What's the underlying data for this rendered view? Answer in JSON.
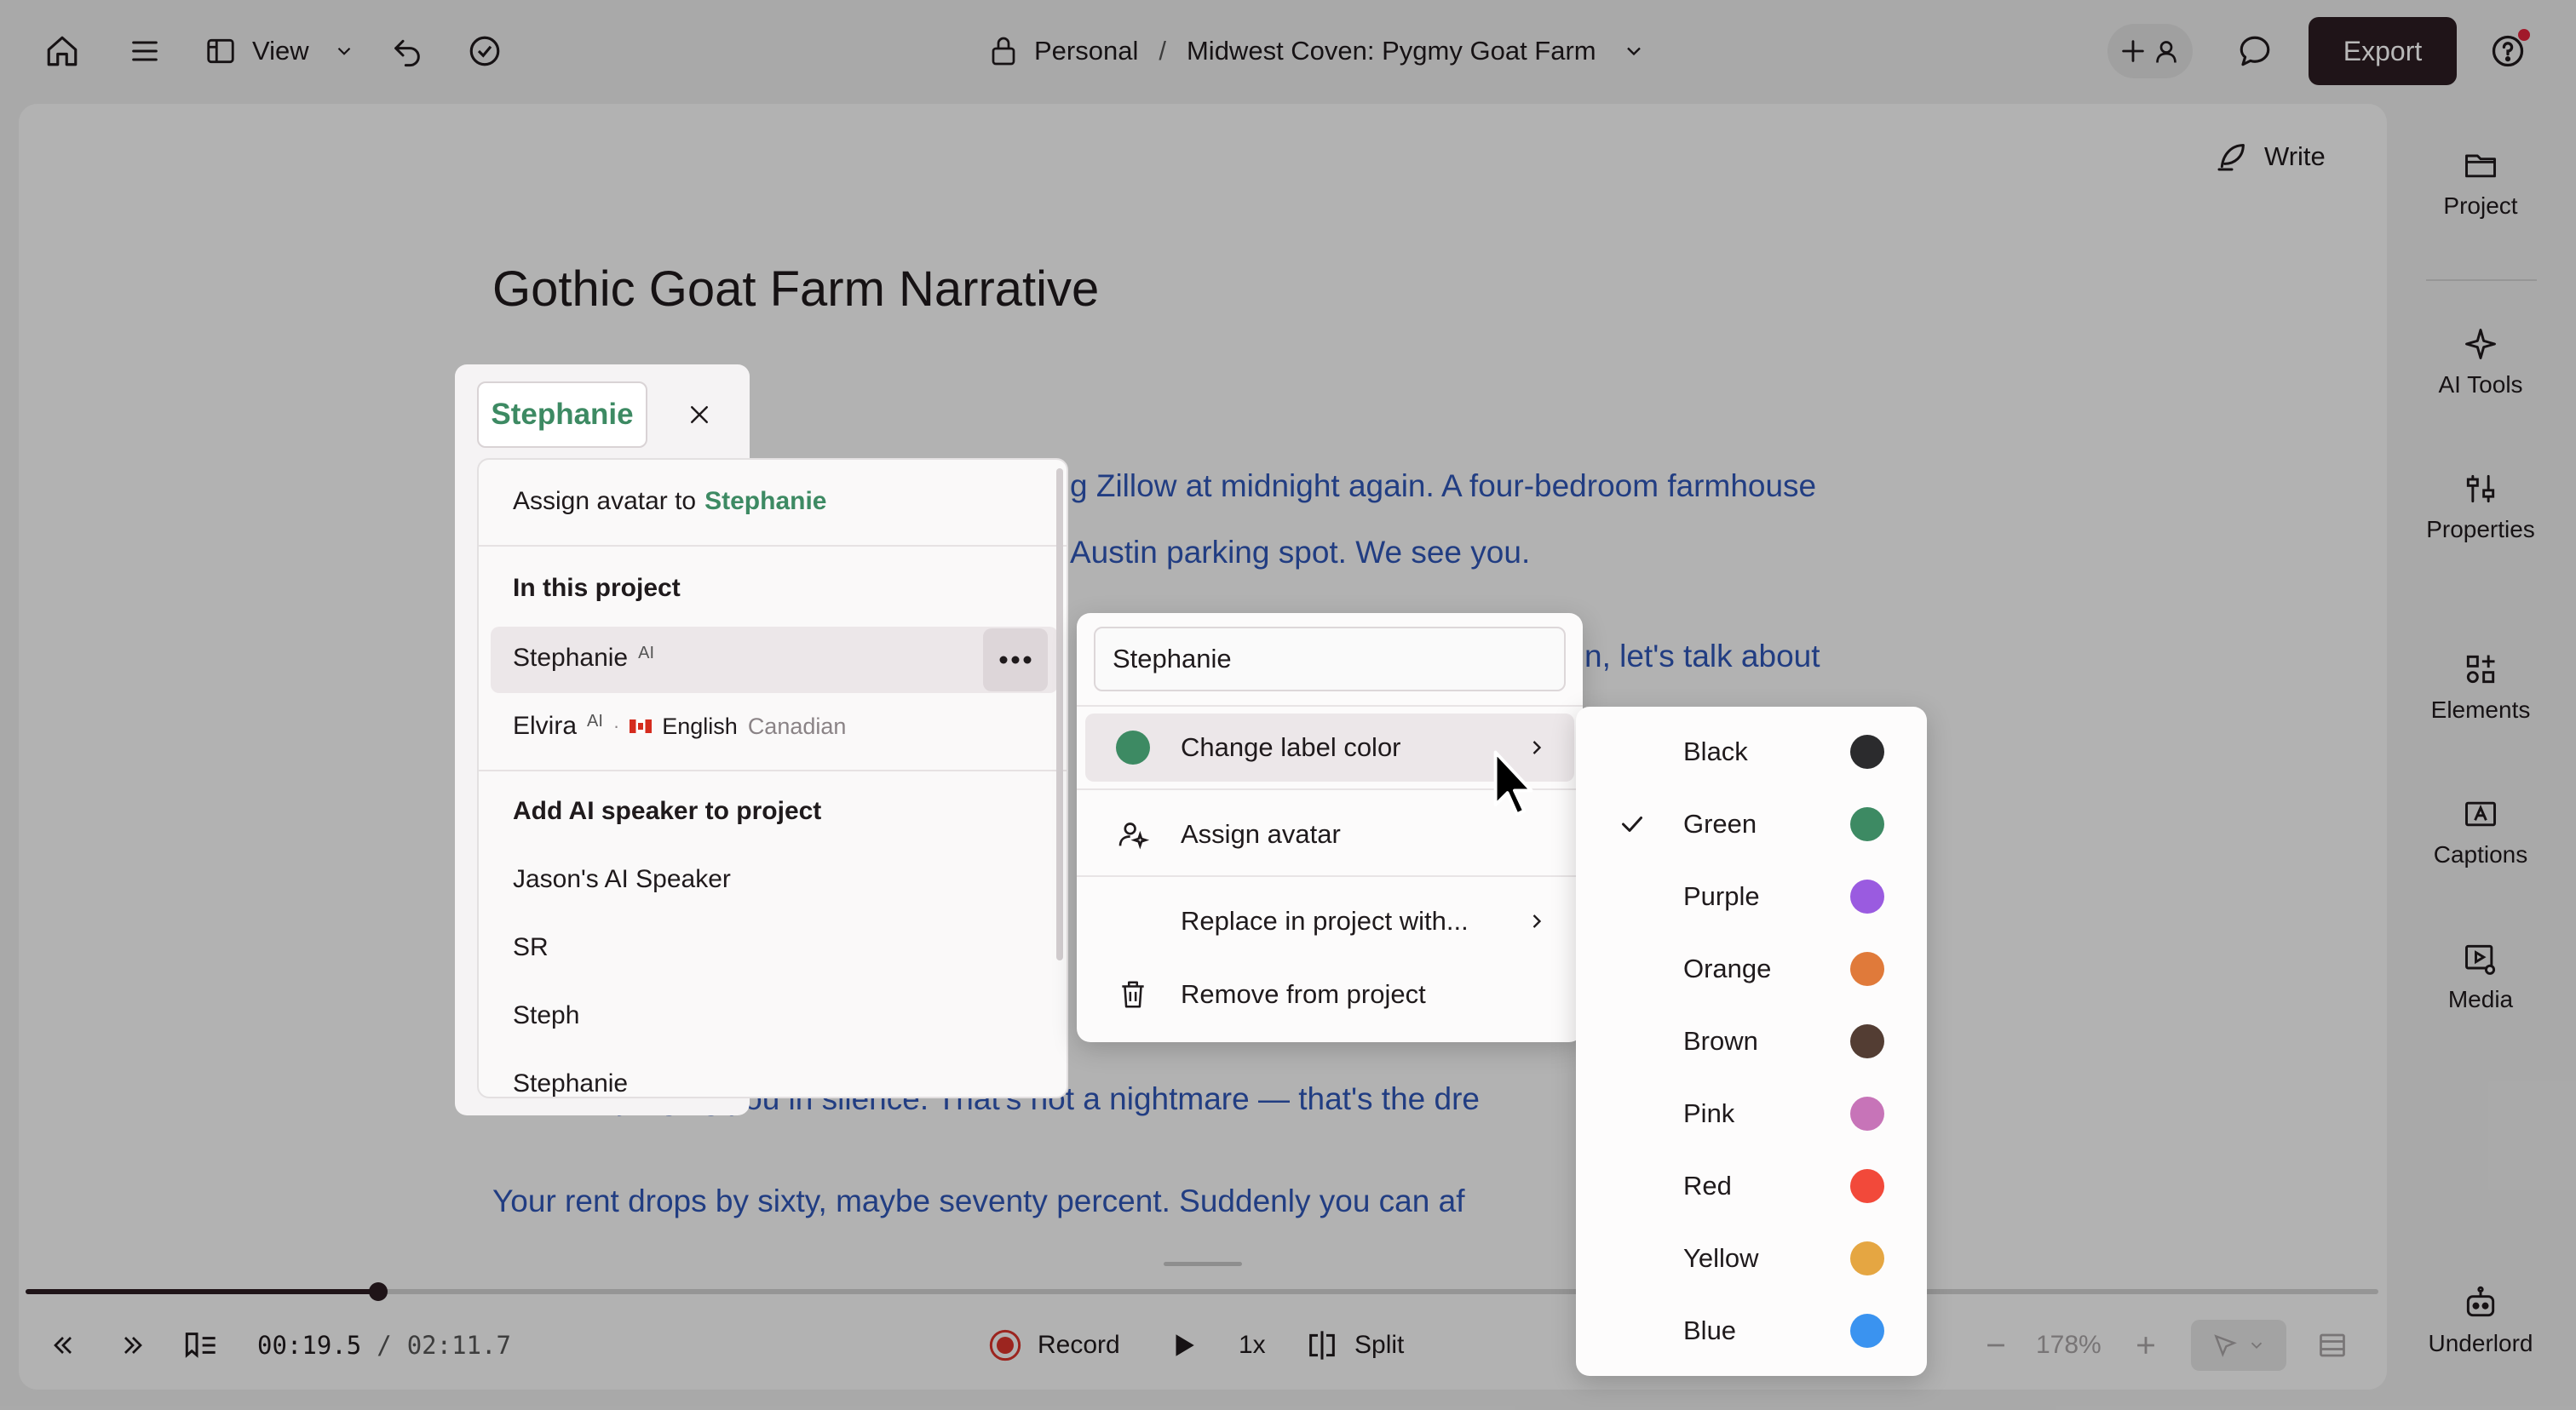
{
  "toolbar": {
    "view_label": "View",
    "breadcrumb_workspace": "Personal",
    "breadcrumb_separator": "/",
    "breadcrumb_project": "Midwest Coven: Pygmy Goat Farm",
    "export_label": "Export"
  },
  "document": {
    "write_label": "Write",
    "title": "Gothic Goat Farm Narrative",
    "visible_lines": [
      "g Zillow at midnight again. A four-bedroom farmhouse",
      "Austin parking spot. We see you.",
      "n, let's talk about",
      "familiars judging you in silence. That's not a nightmare — that's the dre",
      "Your rent drops by sixty, maybe seventy percent. Suddenly you can af"
    ]
  },
  "sidebar": {
    "items": [
      {
        "label": "Project",
        "icon": "folder-icon"
      },
      {
        "label": "AI Tools",
        "icon": "sparkle-icon"
      },
      {
        "label": "Properties",
        "icon": "sliders-icon"
      },
      {
        "label": "Elements",
        "icon": "elements-icon"
      },
      {
        "label": "Captions",
        "icon": "captions-icon"
      },
      {
        "label": "Media",
        "icon": "media-icon"
      },
      {
        "label": "Underlord",
        "icon": "robot-icon"
      }
    ]
  },
  "transport": {
    "current_time": "00:19.5",
    "time_separator": "/",
    "total_time": "02:11.7",
    "record_label": "Record",
    "speed_label": "1x",
    "split_label": "Split",
    "zoom_label": "178%",
    "progress": 0.15
  },
  "speaker_popup": {
    "current_speaker": "Stephanie",
    "assign_prefix": "Assign avatar to",
    "assign_name": "Stephanie",
    "in_project_header": "In this project",
    "in_project": [
      {
        "name": "Stephanie",
        "badge": "AI"
      },
      {
        "name": "Elvira",
        "badge": "AI",
        "dot": "·",
        "flag": "🇨🇦",
        "language": "English",
        "accent": "Canadian"
      }
    ],
    "add_header": "Add AI speaker to project",
    "add_list": [
      "Jason's AI Speaker",
      "SR",
      "Steph",
      "Stephanie"
    ]
  },
  "context_menu": {
    "name_value": "Stephanie",
    "change_color_label": "Change label color",
    "assign_avatar_label": "Assign avatar",
    "replace_label": "Replace in project with...",
    "remove_label": "Remove from project"
  },
  "color_menu": {
    "selected": "Green",
    "options": [
      {
        "name": "Black",
        "color": "#2b2b2d"
      },
      {
        "name": "Green",
        "color": "#3d8a63"
      },
      {
        "name": "Purple",
        "color": "#9a5be0"
      },
      {
        "name": "Orange",
        "color": "#e07a3a"
      },
      {
        "name": "Brown",
        "color": "#533d33"
      },
      {
        "name": "Pink",
        "color": "#c774b8"
      },
      {
        "name": "Red",
        "color": "#f2493a"
      },
      {
        "name": "Yellow",
        "color": "#e5a642"
      },
      {
        "name": "Blue",
        "color": "#3a93f0"
      }
    ]
  },
  "colors": {
    "accent_green": "#3d8a63",
    "export_bg": "#2b1d22",
    "text_blue": "#2f55b5",
    "record_red": "#d9342b"
  }
}
